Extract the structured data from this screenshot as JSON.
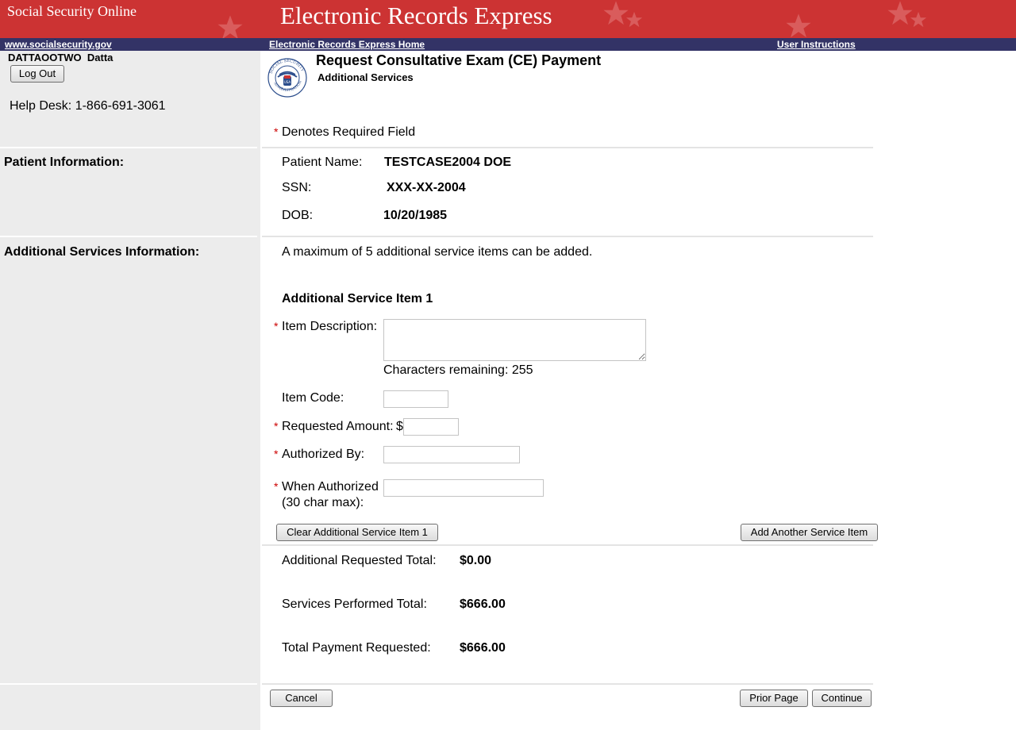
{
  "banner": {
    "site_title": "Social Security Online",
    "app_title": "Electronic Records Express"
  },
  "nav": {
    "ssa_link": "www.socialsecurity.gov",
    "home_link": "Electronic Records Express Home",
    "instructions_link": "User Instructions"
  },
  "user": {
    "name": "DATTAOOTWO  Datta",
    "logout_label": "Log Out",
    "help_desk": "Help Desk: 1-866-691-3061"
  },
  "page": {
    "title": "Request Consultative Exam (CE) Payment",
    "subtitle": "Additional Services",
    "required_note": "Denotes Required Field",
    "required_mark": "*"
  },
  "sections": {
    "patient": "Patient Information:",
    "additional": "Additional Services Information:"
  },
  "patient": {
    "name_label": "Patient Name:",
    "name_value": "TESTCASE2004 DOE",
    "ssn_label": "SSN:",
    "ssn_value": "XXX-XX-2004",
    "dob_label": "DOB:",
    "dob_value": "10/20/1985"
  },
  "services": {
    "max_note": "A maximum of 5 additional service items can be added.",
    "item_heading": "Additional Service Item 1",
    "description_label": "Item Description:",
    "description_value": "",
    "chars_remaining": "Characters remaining: 255",
    "code_label": "Item Code:",
    "code_value": "",
    "amount_label": "Requested Amount:",
    "currency_symbol": "$",
    "amount_value": "",
    "authorized_by_label": "Authorized By:",
    "authorized_by_value": "",
    "when_label_line1": "When Authorized",
    "when_label_line2": "(30 char max):",
    "when_value": "",
    "clear_button": "Clear Additional Service Item 1",
    "add_button": "Add Another Service Item"
  },
  "totals": {
    "additional_label": "Additional Requested Total:",
    "additional_value": "$0.00",
    "performed_label": "Services Performed Total:",
    "performed_value": "$666.00",
    "payment_label": "Total Payment Requested:",
    "payment_value": "$666.00"
  },
  "footer": {
    "cancel_button": "Cancel",
    "prior_button": "Prior Page",
    "continue_button": "Continue"
  },
  "colors": {
    "banner_red": "#cc3333",
    "nav_navy": "#333366",
    "sidebar_gray": "#ececec",
    "required_red": "#cc0000"
  },
  "logo": {
    "top_text": "SOCIAL SECURITY",
    "bottom_text": "ADMINISTRATION",
    "shield_text": "USA"
  }
}
